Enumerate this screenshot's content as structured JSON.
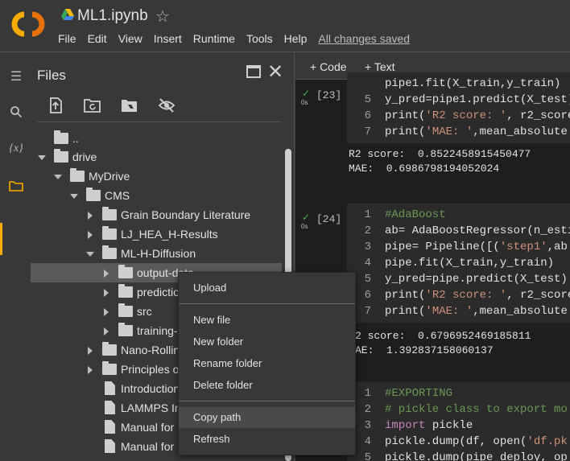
{
  "window": {
    "title": "ML1.ipynb",
    "saved_status": "All changes saved"
  },
  "menu": [
    "File",
    "Edit",
    "View",
    "Insert",
    "Runtime",
    "Tools",
    "Help"
  ],
  "colors": {
    "logo_orange": "#f9ab00",
    "run_ok": "#4caf50"
  },
  "rail": [
    "toc-icon",
    "search-icon",
    "variables-icon",
    "folder-icon"
  ],
  "rail_variables_glyph": "{x}",
  "files": {
    "title": "Files",
    "tools": [
      "upload-icon",
      "refresh-icon",
      "mount-drive-icon",
      "hide-files-icon"
    ],
    "tree": [
      {
        "label": "..",
        "type": "up",
        "depth": 0
      },
      {
        "label": "drive",
        "type": "folder",
        "depth": 0,
        "expanded": true
      },
      {
        "label": "MyDrive",
        "type": "folder",
        "depth": 1,
        "expanded": true
      },
      {
        "label": "CMS",
        "type": "folder",
        "depth": 2,
        "expanded": true
      },
      {
        "label": "Grain Boundary Literature",
        "type": "folder",
        "depth": 3,
        "expanded": false
      },
      {
        "label": "LJ_HEA_H-Results",
        "type": "folder",
        "depth": 3,
        "expanded": false
      },
      {
        "label": "ML-H-Diffusion",
        "type": "folder",
        "depth": 3,
        "expanded": true
      },
      {
        "label": "output-data",
        "type": "folder",
        "depth": 4,
        "expanded": false
      },
      {
        "label": "prediction",
        "type": "folder",
        "depth": 4,
        "expanded": false
      },
      {
        "label": "src",
        "type": "folder",
        "depth": 4,
        "expanded": false
      },
      {
        "label": "training-",
        "type": "folder",
        "depth": 4,
        "expanded": false
      },
      {
        "label": "Nano-Rolling",
        "type": "folder",
        "depth": 3,
        "expanded": false
      },
      {
        "label": "Principles of",
        "type": "folder",
        "depth": 3,
        "expanded": false
      },
      {
        "label": "Introduction",
        "type": "file",
        "depth": 3
      },
      {
        "label": "LAMMPS In",
        "type": "file",
        "depth": 3
      },
      {
        "label": "Manual for",
        "type": "file",
        "depth": 3
      },
      {
        "label": "Manual for",
        "type": "file",
        "depth": 3
      }
    ]
  },
  "toolbar": {
    "add_code": "+ Code",
    "add_text": "+ Text"
  },
  "cells": [
    {
      "count": "[23]",
      "time": "0s",
      "lines": [
        {
          "n": "",
          "html": "<span class='code-text'>pipe1.fit(X_train,y_train)</span>"
        },
        {
          "n": "5",
          "html": "<span class='code-text'>y_pred=pipe1.predict(X_test)</span>"
        },
        {
          "n": "6",
          "html": "<span class='code-text'>print(</span><span class='k-str'>'R2 score: '</span><span class='code-text'>, r2_score</span>"
        },
        {
          "n": "7",
          "html": "<span class='code-text'>print(</span><span class='k-str'>'MAE: '</span><span class='code-text'>,mean_absolute</span>"
        }
      ],
      "output": "R2 score:  0.8522458915450477\nMAE:  0.6986798194052024"
    },
    {
      "count": "[24]",
      "time": "0s",
      "lines": [
        {
          "n": "1",
          "html": "<span class='k-com'>#AdaBoost</span>"
        },
        {
          "n": "2",
          "html": "<span class='code-text'>ab= AdaBoostRegressor(n_esti</span>"
        },
        {
          "n": "3",
          "html": "<span class='code-text'>pipe= Pipeline([(</span><span class='k-str'>'step1'</span><span class='code-text'>,ab</span>"
        },
        {
          "n": "4",
          "html": "<span class='code-text'>pipe.fit(X_train,y_train)</span>"
        },
        {
          "n": "5",
          "html": "<span class='code-text'>y_pred=pipe.predict(X_test)</span>"
        },
        {
          "n": "6",
          "html": "<span class='code-text'>print(</span><span class='k-str'>'R2 score: '</span><span class='code-text'>, r2_score</span>"
        },
        {
          "n": "7",
          "html": "<span class='code-text'>print(</span><span class='k-str'>'MAE: '</span><span class='code-text'>,mean_absolute</span>"
        }
      ],
      "output": "2 score:  0.6796952469185811\nAE:  1.392837158060137"
    },
    {
      "count": "",
      "time": "",
      "lines": [
        {
          "n": "1",
          "html": "<span class='k-com'>#EXPORTING</span>"
        },
        {
          "n": "2",
          "html": "<span class='k-com'># pickle class to export mo</span>"
        },
        {
          "n": "3",
          "html": "<span class='k-kw'>import</span><span class='code-text'> pickle</span>"
        },
        {
          "n": "4",
          "html": "<span class='code-text'>pickle.dump(df, open(</span><span class='k-str'>'df.pk</span>"
        },
        {
          "n": "5",
          "html": "<span class='code-text'>pickle.dump(pipe_deploy, op</span>"
        }
      ],
      "output": ""
    }
  ],
  "context_menu": [
    "Upload",
    "New file",
    "New folder",
    "Rename folder",
    "Delete folder",
    "Copy path",
    "Refresh"
  ]
}
